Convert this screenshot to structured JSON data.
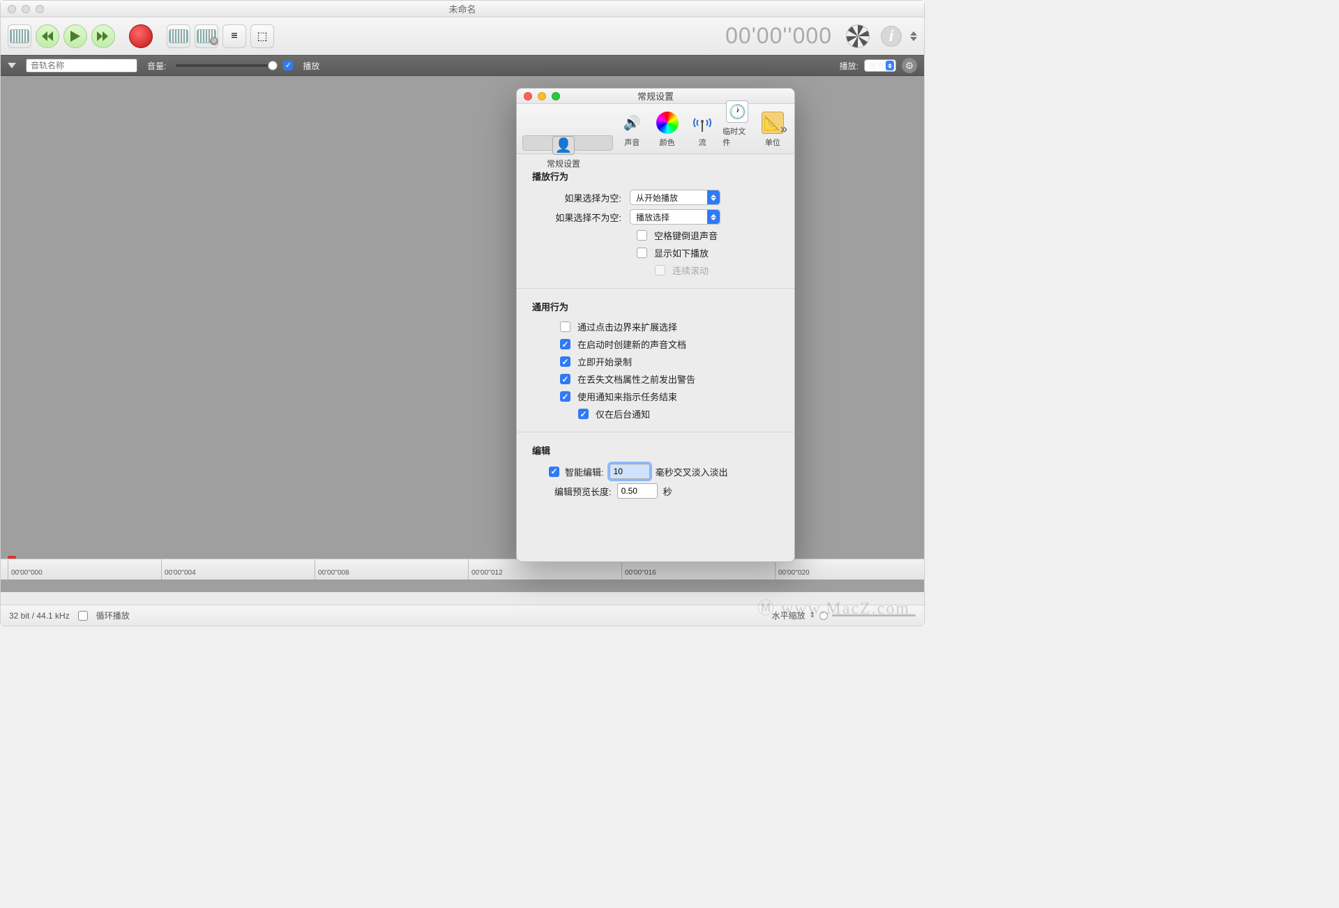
{
  "window": {
    "title": "未命名"
  },
  "toolbar": {
    "timecode": "00'00''000"
  },
  "trackHeader": {
    "placeholder": "音轨名称",
    "volume_label": "音量:",
    "play_label": "播放",
    "playmode_label": "播放:",
    "playmode_value": "前方"
  },
  "ruler": {
    "marks": [
      "00'00''000",
      "00'00''004",
      "00'00''008",
      "00'00''012",
      "00'00''016",
      "00'00''020"
    ]
  },
  "status": {
    "format": "32 bit / 44.1 kHz",
    "loop_label": "循环播放",
    "zoom_label": "水平缩放"
  },
  "watermark": "Ⓜ www.MacZ.com",
  "prefs": {
    "title": "常规设置",
    "tabs": [
      "常规设置",
      "声音",
      "颜色",
      "流",
      "临时文件",
      "单位"
    ],
    "section_playback": "播放行为",
    "empty_label": "如果选择为空:",
    "empty_value": "从开始播放",
    "nonempty_label": "如果选择不为空:",
    "nonempty_value": "播放选择",
    "cb_space_rewind": "空格键倒退声音",
    "cb_show_play": "显示如下播放",
    "cb_cont_scroll": "连续滚动",
    "section_general": "通用行为",
    "cb_extend_sel": "通过点击边界来扩展选择",
    "cb_new_doc": "在启动时创建新的声音文档",
    "cb_start_rec": "立即开始录制",
    "cb_warn_lost": "在丢失文档属性之前发出警告",
    "cb_notify": "使用通知来指示任务结束",
    "cb_notify_bg": "仅在后台通知",
    "section_edit": "编辑",
    "smart_label": "智能编辑:",
    "smart_value": "10",
    "smart_unit": "毫秒交叉淡入淡出",
    "preview_label": "编辑预览长度:",
    "preview_value": "0.50",
    "preview_unit": "秒"
  }
}
